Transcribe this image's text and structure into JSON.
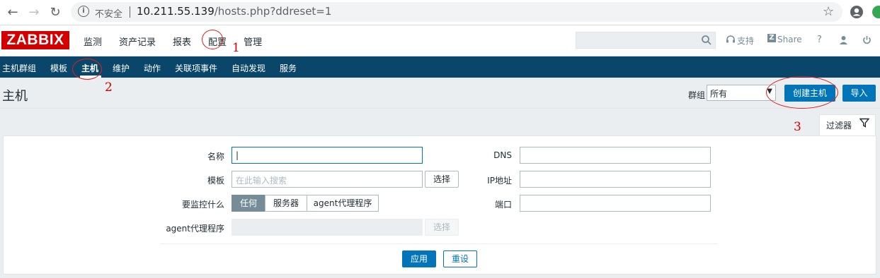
{
  "browser": {
    "insecure_label": "不安全",
    "url_host": "10.211.55.139",
    "url_path": "/hosts.php?ddreset=1"
  },
  "topbar": {
    "logo": "ZABBIX",
    "menu": [
      "监测",
      "资产记录",
      "报表",
      "配置",
      "管理"
    ],
    "support": "支持",
    "share": "Share",
    "help": "?"
  },
  "subnav": {
    "items": [
      "主机群组",
      "模板",
      "主机",
      "维护",
      "动作",
      "关联项事件",
      "自动发现",
      "服务"
    ]
  },
  "header": {
    "title": "主机",
    "group_label": "群组",
    "group_value": "所有",
    "create_button": "创建主机",
    "import_button": "导入"
  },
  "filter": {
    "tab_label": "过滤器",
    "name_label": "名称",
    "name_value": "|",
    "template_label": "模板",
    "template_placeholder": "在此输入搜索",
    "select_label": "选择",
    "monitor_label": "要监控什么",
    "monitor_options": [
      "任何",
      "服务器",
      "agent代理程序"
    ],
    "proxy_label": "agent代理程序",
    "dns_label": "DNS",
    "ip_label": "IP地址",
    "port_label": "端口",
    "apply_button": "应用",
    "reset_button": "重设"
  },
  "annotations": [
    "1",
    "2",
    "3"
  ]
}
